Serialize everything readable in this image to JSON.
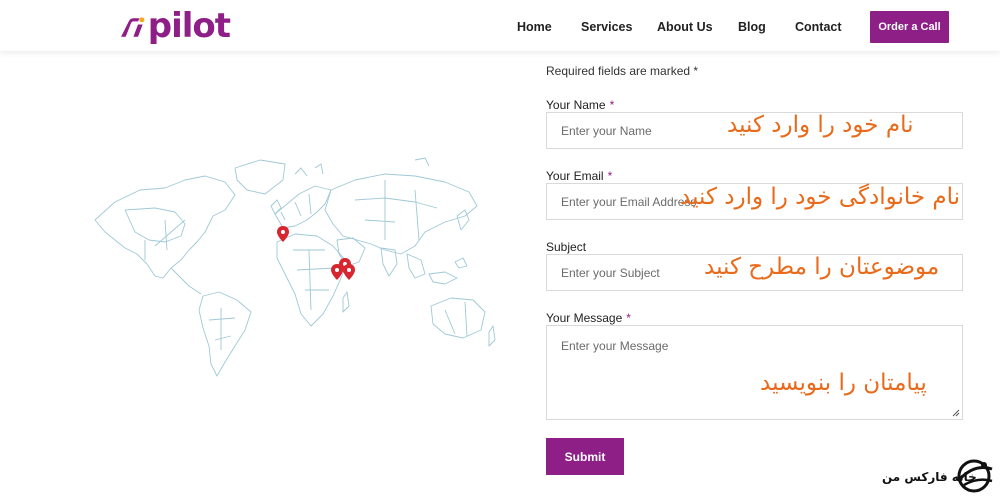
{
  "brand": {
    "name": "pilot",
    "color": "#8e1f86"
  },
  "nav": {
    "items": [
      "Home",
      "Services",
      "About Us",
      "Blog",
      "Contact"
    ],
    "cta_label": "Order a Call"
  },
  "form": {
    "required_note": "Required fields are marked *",
    "name": {
      "label": "Your Name",
      "required": "*",
      "placeholder": "Enter your Name"
    },
    "email": {
      "label": "Your Email",
      "required": "*",
      "placeholder": "Enter your Email Address"
    },
    "subject": {
      "label": "Subject",
      "placeholder": "Enter your Subject"
    },
    "message": {
      "label": "Your Message",
      "required": "*",
      "placeholder": "Enter your Message"
    },
    "submit_label": "Submit"
  },
  "annotations": {
    "name": "نام خود را وارد کنید",
    "email": "نام خانوادگی خود را وارد کنید",
    "subject": "موضوعتان را مطرح کنید",
    "message": "پیامتان را بنویسید",
    "color": "#e86a1a"
  },
  "map": {
    "pin_color": "#d7262f",
    "land_color": "#7fb3c4",
    "pin_count": 4
  },
  "watermark": {
    "text": "خانه فارکس من"
  }
}
